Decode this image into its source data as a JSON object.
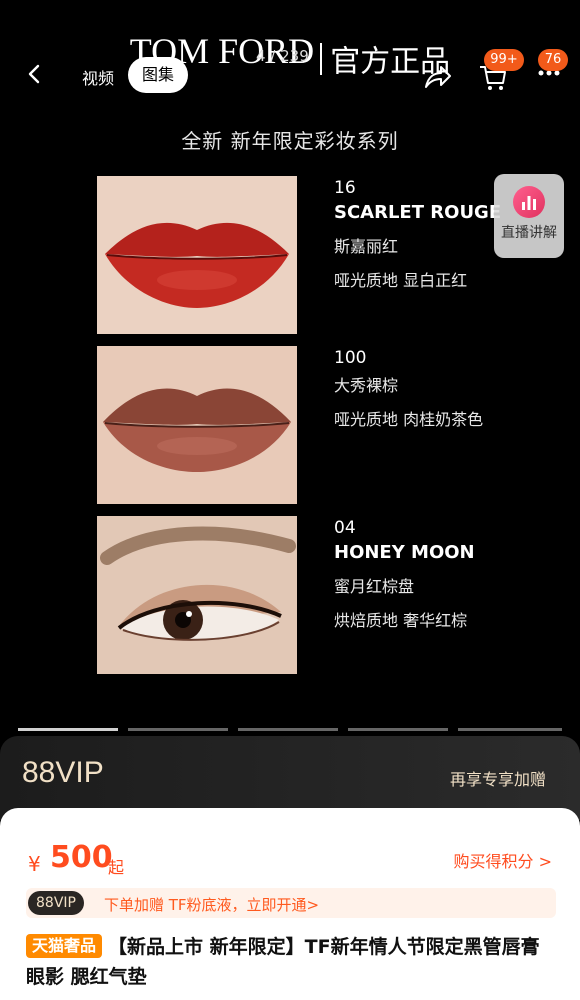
{
  "brand": {
    "en": "TOM FORD",
    "cn": "官方正品"
  },
  "nav": {
    "tab_video": "视频",
    "tab_gallery": "图集",
    "counter": "4 / 239",
    "cart_badge": "99+",
    "more_badge": "76"
  },
  "subtitle": "全新 新年限定彩妆系列",
  "products": [
    {
      "code": "16",
      "name": "SCARLET ROUGE",
      "cn_name": "斯嘉丽红",
      "desc": "哑光质地 显白正红"
    },
    {
      "code": "100",
      "name": "",
      "cn_name": "大秀裸棕",
      "desc": "哑光质地 肉桂奶茶色"
    },
    {
      "code": "04",
      "name": "HONEY MOON",
      "cn_name": "蜜月红棕盘",
      "desc": "烘焙质地 奢华红棕"
    }
  ],
  "live": {
    "label": "直播讲解"
  },
  "vip": {
    "logo": "88VIP",
    "gift": "再享专享加赠"
  },
  "price": {
    "symbol": "¥",
    "value": "500",
    "suffix": "起",
    "points": "购买得积分 >"
  },
  "promo": {
    "tag": "88VIP",
    "text": "下单加赠 TF粉底液，立即开通>"
  },
  "title": {
    "tag": "天猫奢品",
    "text": "【新品上市 新年限定】TF新年情人节限定黑管唇膏 眼影 腮红气垫"
  },
  "colors": {
    "accent": "#ff4c1f",
    "badge": "#f25a1a",
    "gold": "#f1e0c6"
  }
}
